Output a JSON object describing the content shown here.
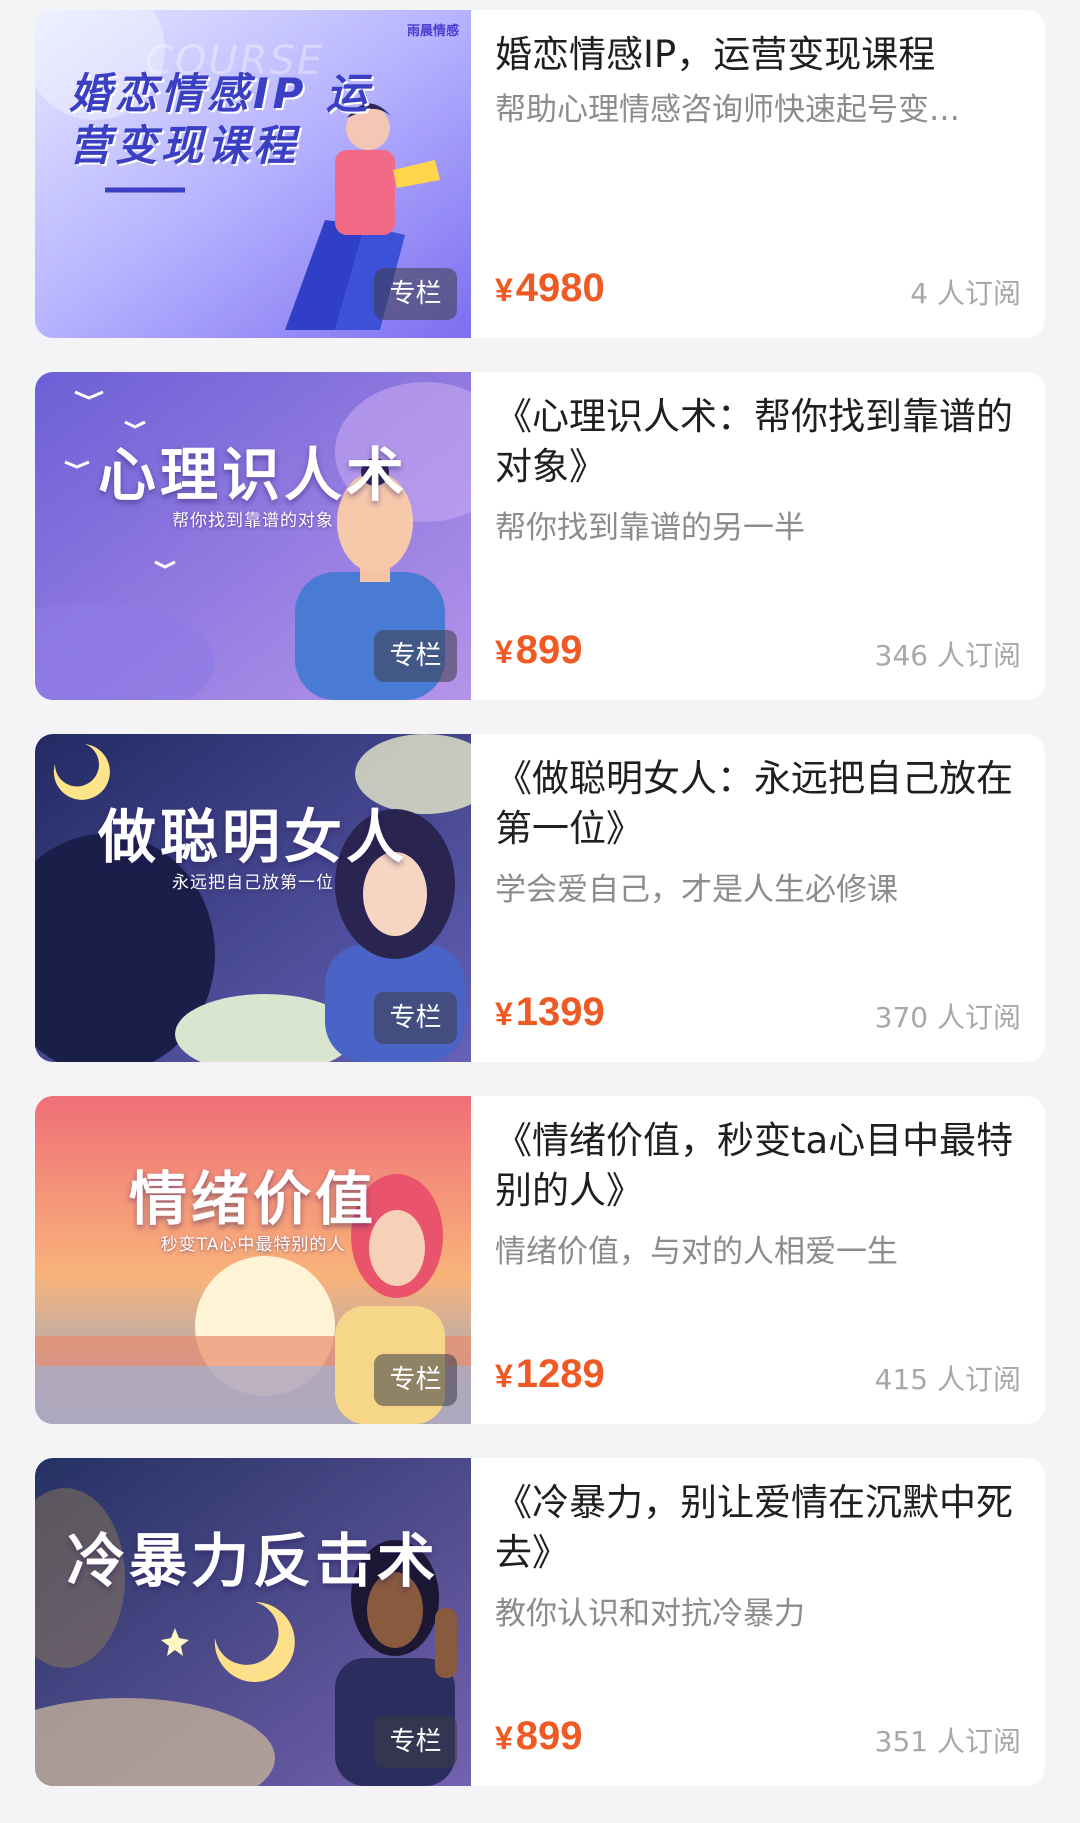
{
  "courses": [
    {
      "title": "婚恋情感IP，运营变现课程",
      "desc": "帮助心理情感咨询师快速起号变…",
      "currency": "¥",
      "price": "4980",
      "subscribers": "4 人订阅",
      "badge": "专栏",
      "cover": {
        "title": "婚恋情感IP 运营变现课程",
        "ghost": "COURSE",
        "brand": "雨晨情感",
        "colors": [
          "#d9dcff",
          "#8c7cf2"
        ]
      }
    },
    {
      "title": "《心理识人术：帮你找到靠谱的对象》",
      "desc": "帮你找到靠谱的另一半",
      "currency": "¥",
      "price": "899",
      "subscribers": "346 人订阅",
      "badge": "专栏",
      "cover": {
        "title": "心理识人术",
        "subtitle": "帮你找到靠谱的对象",
        "colors": [
          "#7d6fe0",
          "#a98be8"
        ]
      }
    },
    {
      "title": "《做聪明女人：永远把自己放在第一位》",
      "desc": "学会爱自己，才是人生必修课",
      "currency": "¥",
      "price": "1399",
      "subscribers": "370 人订阅",
      "badge": "专栏",
      "cover": {
        "title": "做聪明女人",
        "subtitle": "永远把自己放第一位",
        "colors": [
          "#2a2f6e",
          "#5f5bb3"
        ]
      }
    },
    {
      "title": "《情绪价值，秒变ta心目中最特别的人》",
      "desc": "情绪价值，与对的人相爱一生",
      "currency": "¥",
      "price": "1289",
      "subscribers": "415 人订阅",
      "badge": "专栏",
      "cover": {
        "title": "情绪价值",
        "subtitle": "秒变TA心中最特别的人",
        "colors": [
          "#f27a6d",
          "#fbc27a"
        ]
      }
    },
    {
      "title": "《冷暴力，别让爱情在沉默中死去》",
      "desc": "教你认识和对抗冷暴力",
      "currency": "¥",
      "price": "899",
      "subscribers": "351 人订阅",
      "badge": "专栏",
      "cover": {
        "title": "冷暴力反击术",
        "colors": [
          "#2c3a6e",
          "#6a5aa8"
        ]
      }
    }
  ]
}
